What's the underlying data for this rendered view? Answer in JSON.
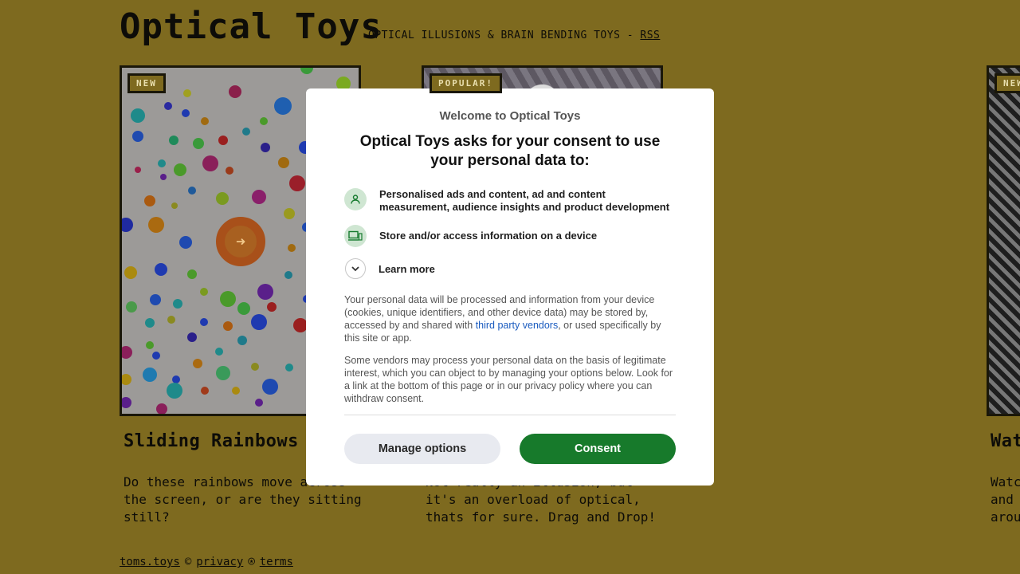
{
  "site": {
    "title": "Optical Toys",
    "tagline": "OPTICAL ILLUSIONS & BRAIN BENDING TOYS - ",
    "rss_label": "RSS"
  },
  "cards": [
    {
      "badge": "NEW",
      "title": "Sliding Rainbows",
      "description": "Do these rainbows move across\nthe screen, or are they sitting\nstill?"
    },
    {
      "badge": "POPULAR!",
      "title": "",
      "description": "Not really an illusion, but\nit's an overload of optical,\nthats for sure. Drag and Drop!"
    },
    {
      "badge": "NEW",
      "title": "Wat",
      "description": "Watc\nand \naroun"
    }
  ],
  "footer": {
    "site_link": "toms.toys",
    "copyright": "©",
    "privacy_link": "privacy",
    "separator": "⍟",
    "terms_link": "terms"
  },
  "consent": {
    "eyebrow": "Welcome to Optical Toys",
    "heading": "Optical Toys asks for your consent to use your personal data to:",
    "purposes": [
      {
        "icon": "person-icon",
        "text": "Personalised ads and content, ad and content measurement, audience insights and product development"
      },
      {
        "icon": "device-icon",
        "text": "Store and/or access information on a device"
      }
    ],
    "learn_more": "Learn more",
    "body1_prefix": "Your personal data will be processed and information from your device (cookies, unique identifiers, and other device data) may be stored by, accessed by and shared with ",
    "body1_link": "third party vendors",
    "body1_suffix": ", or used specifically by this site or app.",
    "body2": "Some vendors may process your personal data on the basis of legitimate interest, which you can object to by managing your options below. Look for a link at the bottom of this page or in our privacy policy where you can withdraw consent.",
    "manage_label": "Manage options",
    "consent_label": "Consent"
  },
  "colors": {
    "page_bg": "#7e6a1f",
    "consent_green": "#177a2b",
    "link_blue": "#1a5bbf"
  }
}
